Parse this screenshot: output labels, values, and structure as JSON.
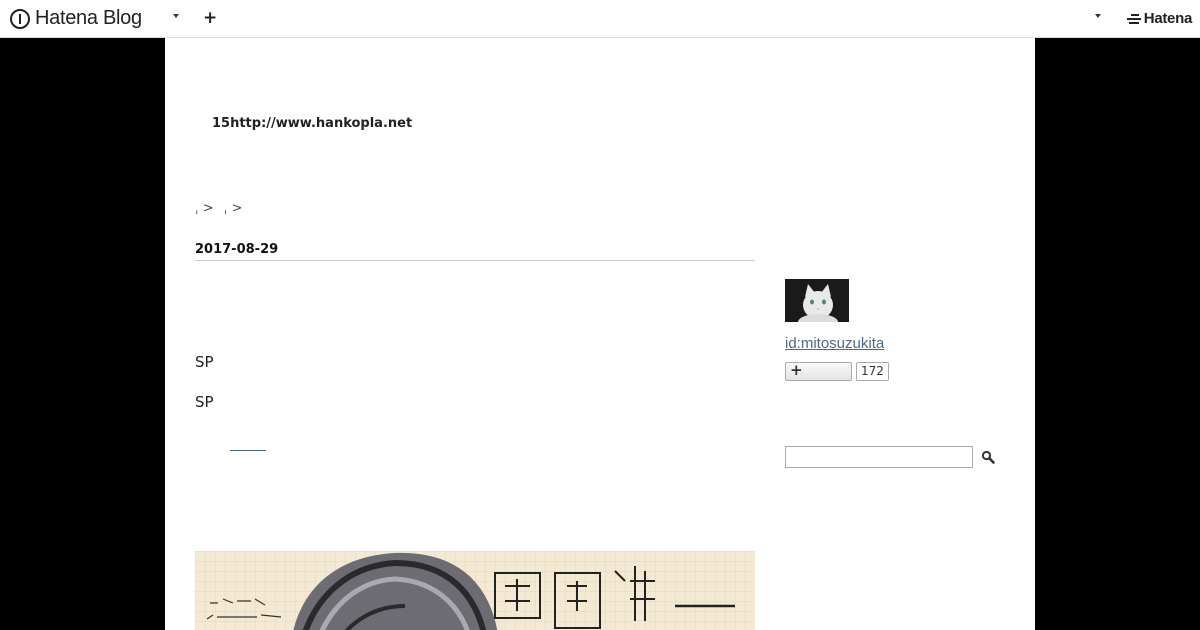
{
  "global_header": {
    "logo_text": "Hatena Blog",
    "add_label": "+",
    "hatena_text": "Hatena"
  },
  "blog": {
    "title": "15http://www.hankopla.net"
  },
  "breadcrumb": {
    "items": [
      "ˌ >",
      "ˌ >"
    ]
  },
  "entry": {
    "date": "2017-08-29",
    "lines": [
      "SP",
      "SP"
    ]
  },
  "sidebar": {
    "profile_id": "id:mitosuzukita",
    "follow_label": "+",
    "follower_count": "172"
  },
  "search": {
    "placeholder": ""
  },
  "icons": {
    "logo": "hatena-blog-logo-icon",
    "dropdown": "chevron-down-icon",
    "search": "search-icon"
  }
}
